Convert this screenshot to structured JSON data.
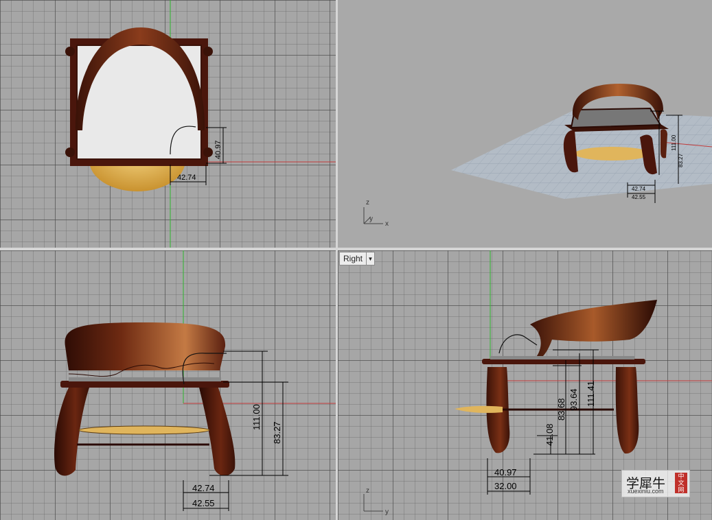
{
  "viewports": {
    "top": {
      "dims": [
        "40.97",
        "42.74"
      ]
    },
    "perspective": {
      "dims": [
        "111.00",
        "83.27",
        "42.74",
        "42.55"
      ],
      "axis": [
        "z",
        "y",
        "x"
      ]
    },
    "front": {
      "dims": [
        "111.00",
        "83.27",
        "42.74",
        "42.55"
      ]
    },
    "right": {
      "label": "Right",
      "dims": [
        "111.41",
        "93.64",
        "83.68",
        "41.08",
        "40.97",
        "32.00"
      ],
      "axis": [
        "z",
        "y"
      ]
    }
  },
  "watermark": {
    "main": "学犀牛",
    "sub": "xuexiniu.com",
    "badge": [
      "中",
      "文",
      "网"
    ]
  },
  "colors": {
    "viewport_bg": "#a6a6a6",
    "x_axis": "#c23a3a",
    "y_axis": "#2fb52f",
    "wood_dark": "#4a160c",
    "wood_light": "#c0703a",
    "cushion": "#e8c067"
  }
}
